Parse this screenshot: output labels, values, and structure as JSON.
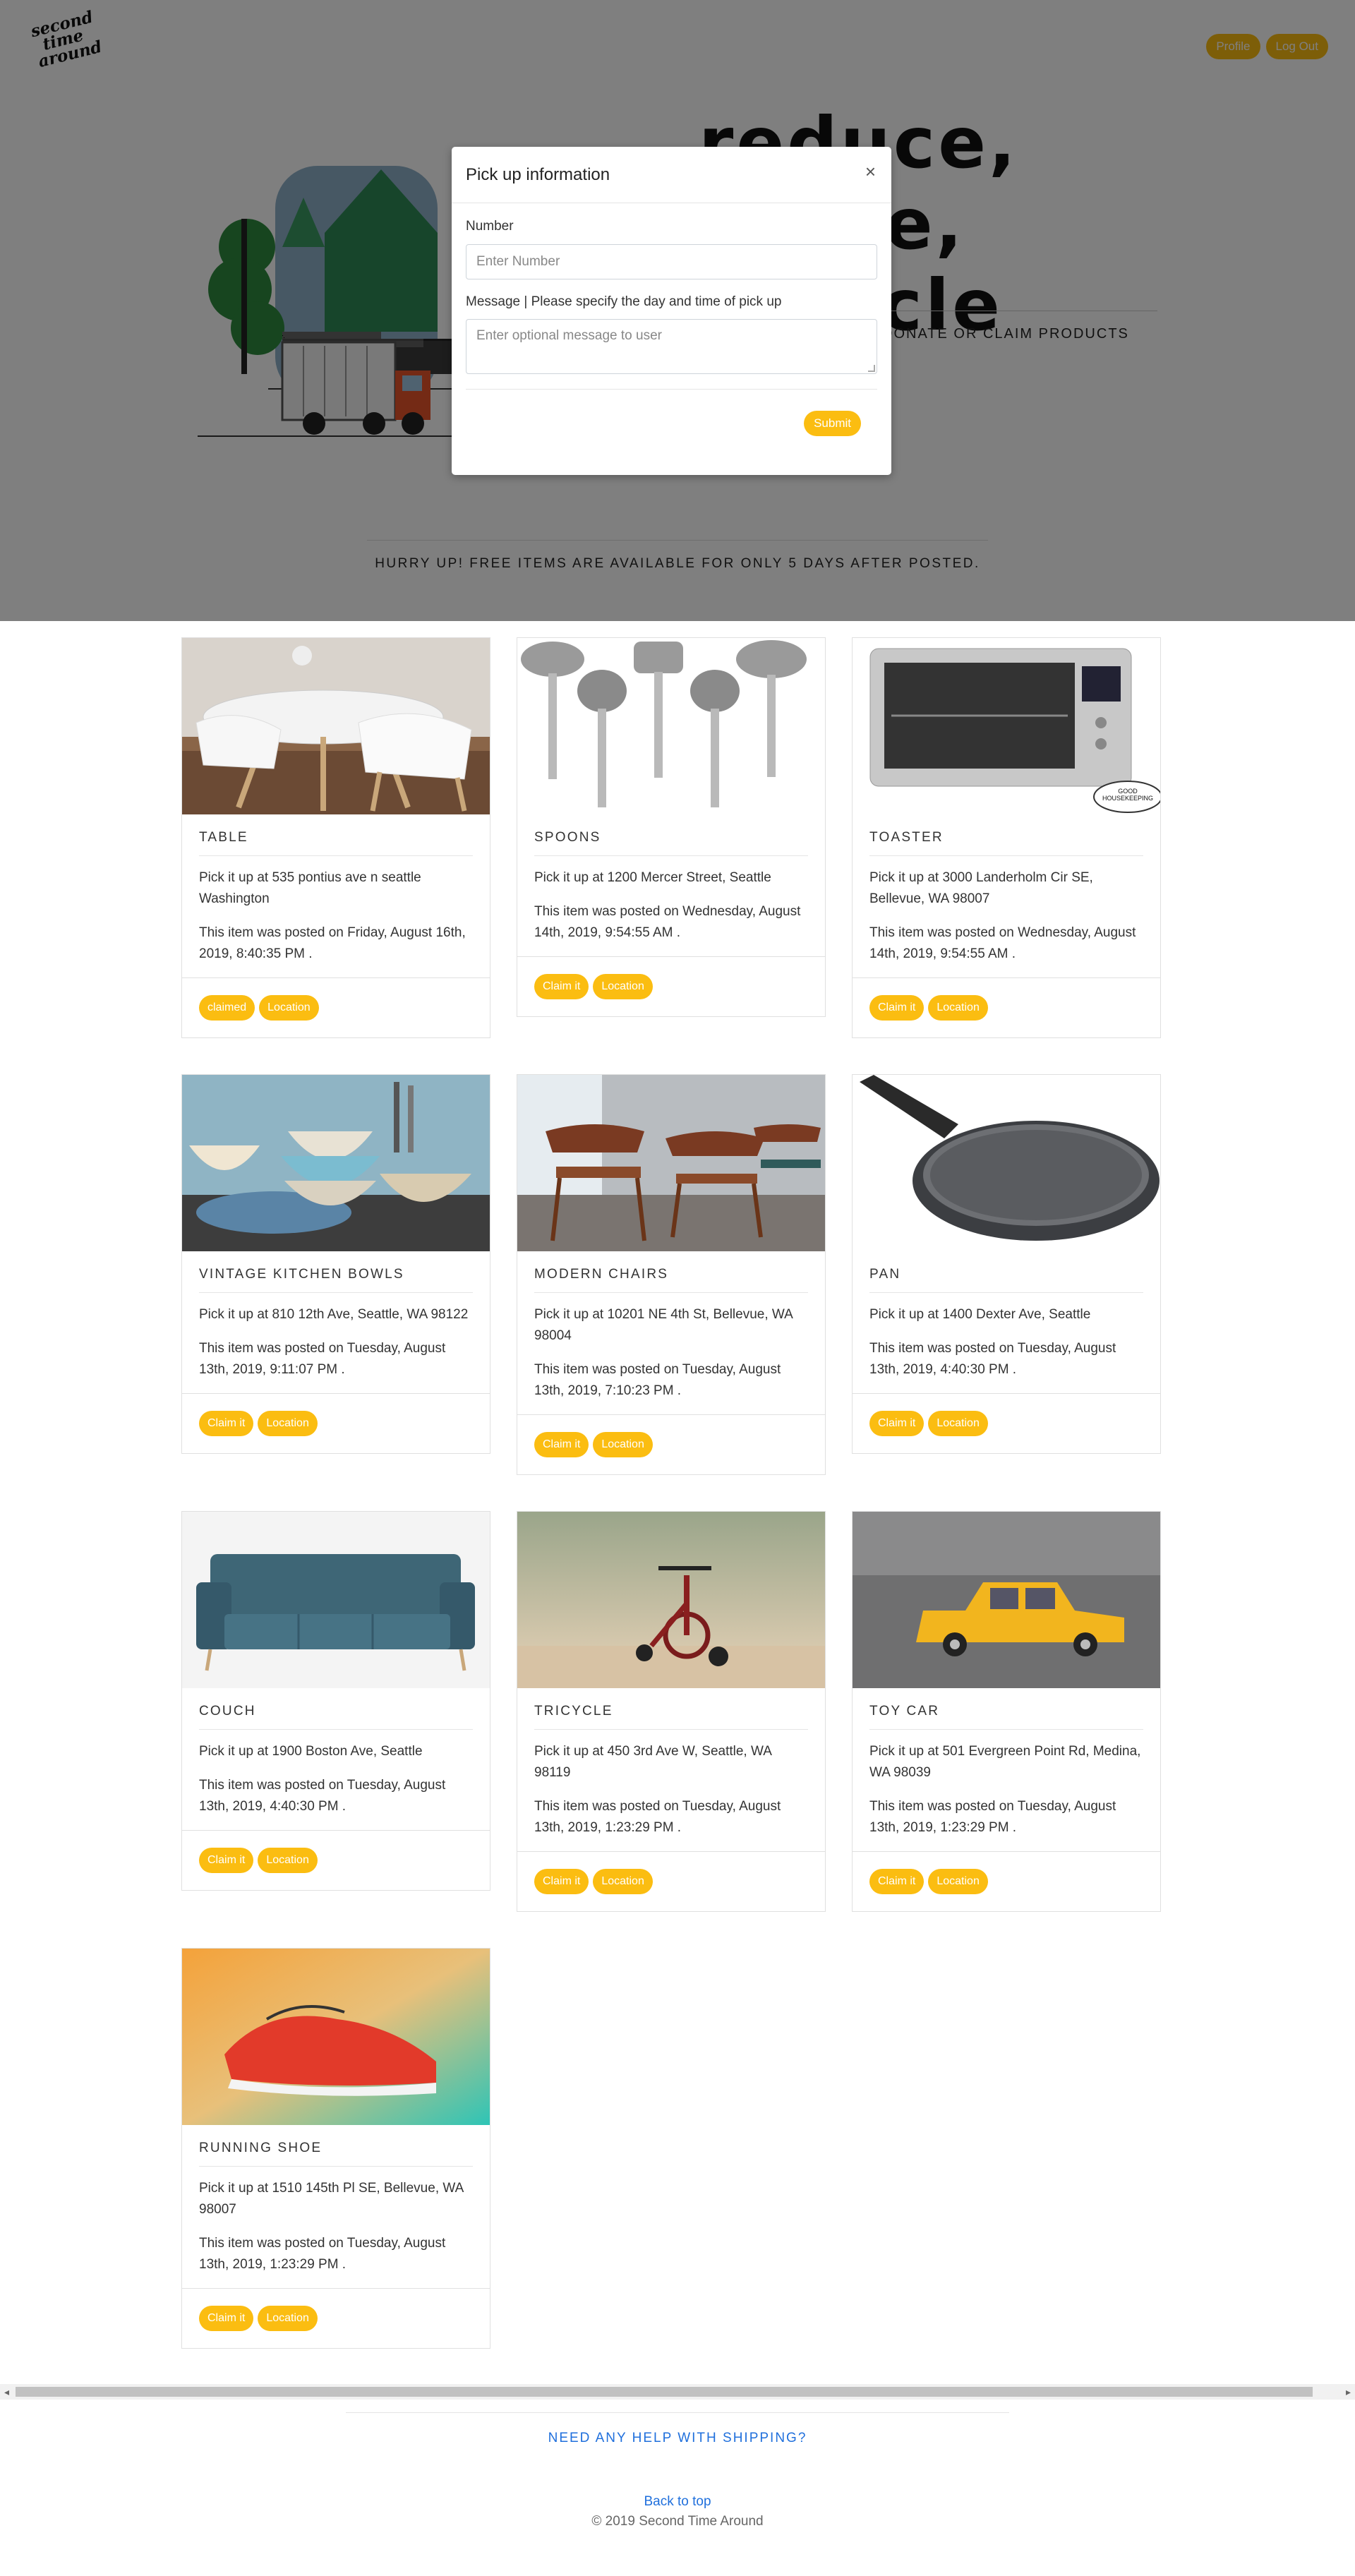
{
  "header": {
    "logo": [
      "second",
      "time",
      "around"
    ],
    "profile_label": "Profile",
    "logout_label": "Log Out"
  },
  "hero": {
    "words": [
      "reduce,",
      "reuse,",
      "recycle"
    ],
    "subtitle": "DONATE OR CLAIM PRODUCTS",
    "hurry": "HURRY UP! FREE ITEMS ARE AVAILABLE FOR ONLY 5 DAYS AFTER POSTED."
  },
  "modal": {
    "title": "Pick up information",
    "close": "×",
    "number_label": "Number",
    "number_placeholder": "Enter Number",
    "message_label": "Message | Please specify the day and time of pick up",
    "message_placeholder": "Enter optional message to user",
    "submit_label": "Submit"
  },
  "items": [
    {
      "title": "TABLE",
      "pickup": "Pick it up at 535 pontius ave n seattle Washington",
      "posted": "This item was posted on Friday, August 16th, 2019, 8:40:35 PM .",
      "claim_label": "claimed",
      "location_label": "Location"
    },
    {
      "title": "SPOONS",
      "pickup": "Pick it up at 1200 Mercer Street, Seattle",
      "posted": "This item was posted on Wednesday, August 14th, 2019, 9:54:55 AM .",
      "claim_label": "Claim it",
      "location_label": "Location"
    },
    {
      "title": "TOASTER",
      "pickup": "Pick it up at 3000 Landerholm Cir SE, Bellevue, WA 98007",
      "posted": "This item was posted on Wednesday, August 14th, 2019, 9:54:55 AM .",
      "claim_label": "Claim it",
      "location_label": "Location",
      "badge": [
        "GOOD",
        "HOUSEKEEPING"
      ]
    },
    {
      "title": "VINTAGE KITCHEN BOWLS",
      "pickup": "Pick it up at 810 12th Ave, Seattle, WA 98122",
      "posted": "This item was posted on Tuesday, August 13th, 2019, 9:11:07 PM .",
      "claim_label": "Claim it",
      "location_label": "Location"
    },
    {
      "title": "MODERN CHAIRS",
      "pickup": "Pick it up at 10201 NE 4th St, Bellevue, WA 98004",
      "posted": "This item was posted on Tuesday, August 13th, 2019, 7:10:23 PM .",
      "claim_label": "Claim it",
      "location_label": "Location"
    },
    {
      "title": "PAN",
      "pickup": "Pick it up at 1400 Dexter Ave, Seattle",
      "posted": "This item was posted on Tuesday, August 13th, 2019, 4:40:30 PM .",
      "claim_label": "Claim it",
      "location_label": "Location"
    },
    {
      "title": "COUCH",
      "pickup": "Pick it up at 1900 Boston Ave, Seattle",
      "posted": "This item was posted on Tuesday, August 13th, 2019, 4:40:30 PM .",
      "claim_label": "Claim it",
      "location_label": "Location"
    },
    {
      "title": "TRICYCLE",
      "pickup": "Pick it up at 450 3rd Ave W, Seattle, WA 98119",
      "posted": "This item was posted on Tuesday, August 13th, 2019, 1:23:29 PM .",
      "claim_label": "Claim it",
      "location_label": "Location"
    },
    {
      "title": "TOY CAR",
      "pickup": "Pick it up at 501 Evergreen Point Rd, Medina, WA 98039",
      "posted": "This item was posted on Tuesday, August 13th, 2019, 1:23:29 PM .",
      "claim_label": "Claim it",
      "location_label": "Location"
    },
    {
      "title": "RUNNING SHOE",
      "pickup": "Pick it up at 1510 145th Pl SE, Bellevue, WA 98007",
      "posted": "This item was posted on Tuesday, August 13th, 2019, 1:23:29 PM .",
      "claim_label": "Claim it",
      "location_label": "Location"
    }
  ],
  "footer": {
    "help": "NEED ANY HELP WITH SHIPPING?",
    "back_to_top": "Back to top",
    "copyright": "© 2019 Second Time Around"
  },
  "colors": {
    "accent": "#fbbd11",
    "link": "#1f6fdc",
    "overlay": "rgba(0,0,0,0.5)"
  }
}
